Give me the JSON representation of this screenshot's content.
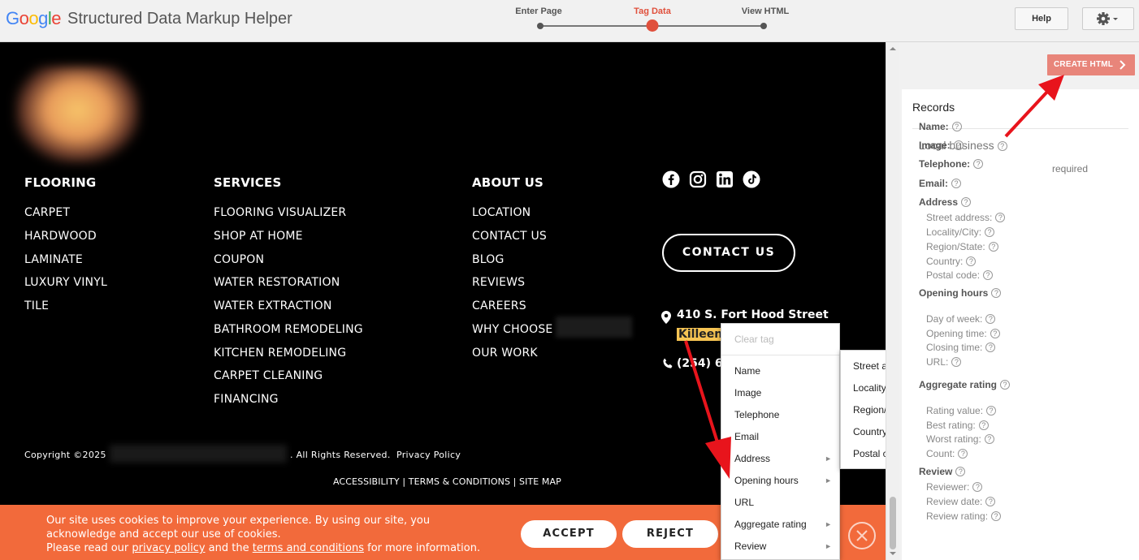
{
  "topbar": {
    "logo": "Google",
    "app_title": "Structured Data Markup Helper",
    "steps": [
      {
        "label": "Enter Page",
        "active": false
      },
      {
        "label": "Tag Data",
        "active": true
      },
      {
        "label": "View HTML",
        "active": false
      }
    ],
    "help_label": "Help",
    "settings_icon": "gear-icon"
  },
  "site": {
    "columns": {
      "flooring": {
        "heading": "FLOORING",
        "items": [
          "CARPET",
          "HARDWOOD",
          "LAMINATE",
          "LUXURY VINYL",
          "TILE"
        ]
      },
      "services": {
        "heading": "SERVICES",
        "items": [
          "FLOORING VISUALIZER",
          "SHOP AT HOME",
          "COUPON",
          "WATER RESTORATION",
          "WATER EXTRACTION",
          "BATHROOM REMODELING",
          "KITCHEN REMODELING",
          "CARPET CLEANING",
          "FINANCING"
        ]
      },
      "about": {
        "heading": "ABOUT US",
        "items": [
          "LOCATION",
          "CONTACT US",
          "BLOG",
          "REVIEWS",
          "CAREERS",
          "WHY CHOOSE",
          "OUR WORK"
        ]
      }
    },
    "social_icons": [
      "facebook-icon",
      "instagram-icon",
      "linkedin-icon",
      "tiktok-icon"
    ],
    "contact_button": "CONTACT US",
    "address_line1": "410 S. Fort Hood Street",
    "address_line2": "Killeen",
    "phone_partial": "(254) 6",
    "copyright": "Copyright ©2025",
    "rights": ". All Rights Reserved.",
    "privacy": "Privacy Policy",
    "footer_links": "ACCESSIBILITY | TERMS & CONDITIONS | SITE MAP"
  },
  "cookie": {
    "line1": "Our site uses cookies to improve your experience. By using our site, you",
    "line2": "acknowledge and accept our use of cookies.",
    "line3_pre": "Please read our ",
    "privacy_link": "privacy policy",
    "line3_mid": " and the ",
    "terms_link": "terms and conditions",
    "line3_post": " for more information.",
    "accept": "ACCEPT",
    "reject": "REJECT"
  },
  "tag_menu": {
    "clear_tag": "Clear tag",
    "items": [
      {
        "label": "Name",
        "has_sub": false
      },
      {
        "label": "Image",
        "has_sub": false
      },
      {
        "label": "Telephone",
        "has_sub": false
      },
      {
        "label": "Email",
        "has_sub": false
      },
      {
        "label": "Address",
        "has_sub": true
      },
      {
        "label": "Opening hours",
        "has_sub": true
      },
      {
        "label": "URL",
        "has_sub": false
      },
      {
        "label": "Aggregate rating",
        "has_sub": true
      },
      {
        "label": "Review",
        "has_sub": true
      }
    ]
  },
  "address_submenu": [
    "Street address",
    "Locality/City",
    "Region/State",
    "Country",
    "Postal code"
  ],
  "panel": {
    "create_html": "CREATE HTML",
    "records_title": "Records",
    "type_title": "Local business",
    "required": "required",
    "fields": [
      {
        "label": "Name:",
        "kind": "field"
      },
      {
        "label": "Image:",
        "kind": "field"
      },
      {
        "label": "Telephone:",
        "kind": "field"
      },
      {
        "label": "Email:",
        "kind": "field"
      },
      {
        "label": "Address",
        "kind": "field"
      },
      {
        "label": "Street address:",
        "kind": "sub"
      },
      {
        "label": "Locality/City:",
        "kind": "sub"
      },
      {
        "label": "Region/State:",
        "kind": "sub"
      },
      {
        "label": "Country:",
        "kind": "sub"
      },
      {
        "label": "Postal code:",
        "kind": "sub"
      },
      {
        "label": "Opening hours",
        "kind": "field"
      },
      {
        "label": "Day of week:",
        "kind": "sub"
      },
      {
        "label": "Opening time:",
        "kind": "sub"
      },
      {
        "label": "Closing time:",
        "kind": "sub"
      },
      {
        "label": "URL:",
        "kind": "sub"
      },
      {
        "label": "Aggregate rating",
        "kind": "field"
      },
      {
        "label": "Rating value:",
        "kind": "sub"
      },
      {
        "label": "Best rating:",
        "kind": "sub"
      },
      {
        "label": "Worst rating:",
        "kind": "sub"
      },
      {
        "label": "Count:",
        "kind": "sub"
      },
      {
        "label": "Review",
        "kind": "field"
      },
      {
        "label": "Reviewer:",
        "kind": "sub"
      },
      {
        "label": "Review date:",
        "kind": "sub"
      },
      {
        "label": "Review rating:",
        "kind": "sub"
      }
    ]
  },
  "colors": {
    "accent": "#e0503c",
    "cookie_bg": "#f26a3b",
    "highlight": "#f6c453",
    "create_btn": "#e8857a"
  }
}
